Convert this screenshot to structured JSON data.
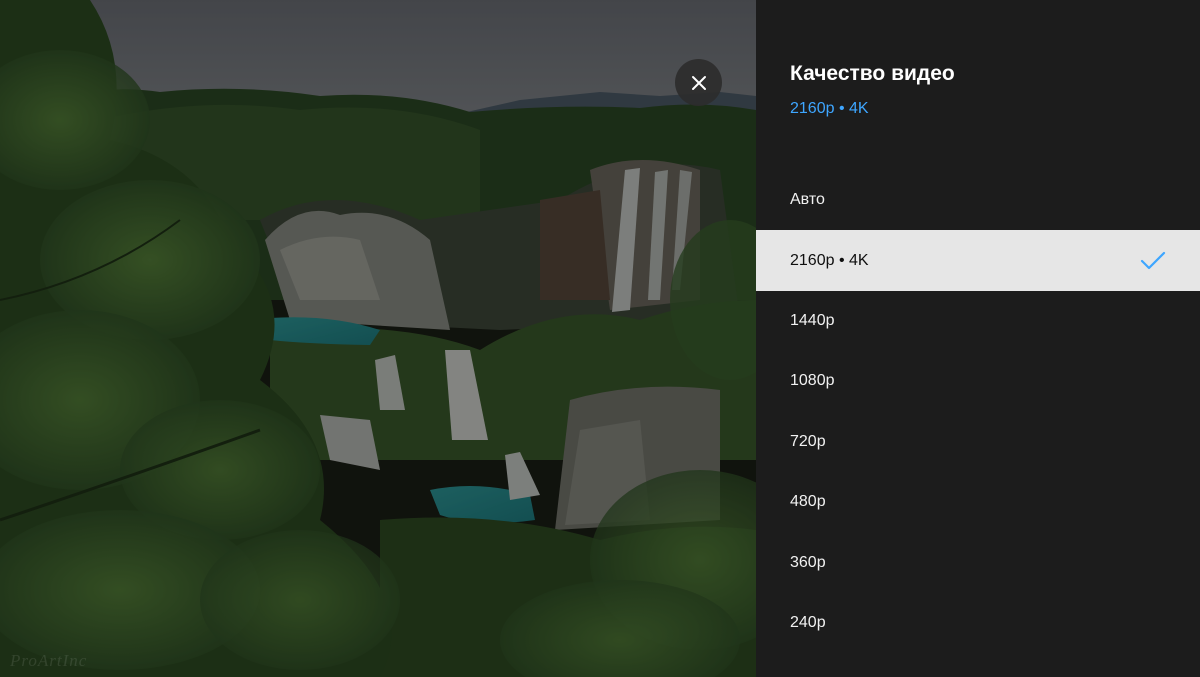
{
  "video": {
    "watermark": "ProArtInc"
  },
  "close_button": {
    "icon": "close-icon",
    "label": "×"
  },
  "panel": {
    "title": "Качество видео",
    "subtitle": "2160p • 4K",
    "accent_color": "#3ea6ff",
    "options": [
      {
        "label": "Авто",
        "selected": false
      },
      {
        "label": "2160p • 4K",
        "selected": true
      },
      {
        "label": "1440p",
        "selected": false
      },
      {
        "label": "1080p",
        "selected": false
      },
      {
        "label": "720p",
        "selected": false
      },
      {
        "label": "480p",
        "selected": false
      },
      {
        "label": "360p",
        "selected": false
      },
      {
        "label": "240p",
        "selected": false
      }
    ],
    "check_icon": "checkmark-icon"
  }
}
